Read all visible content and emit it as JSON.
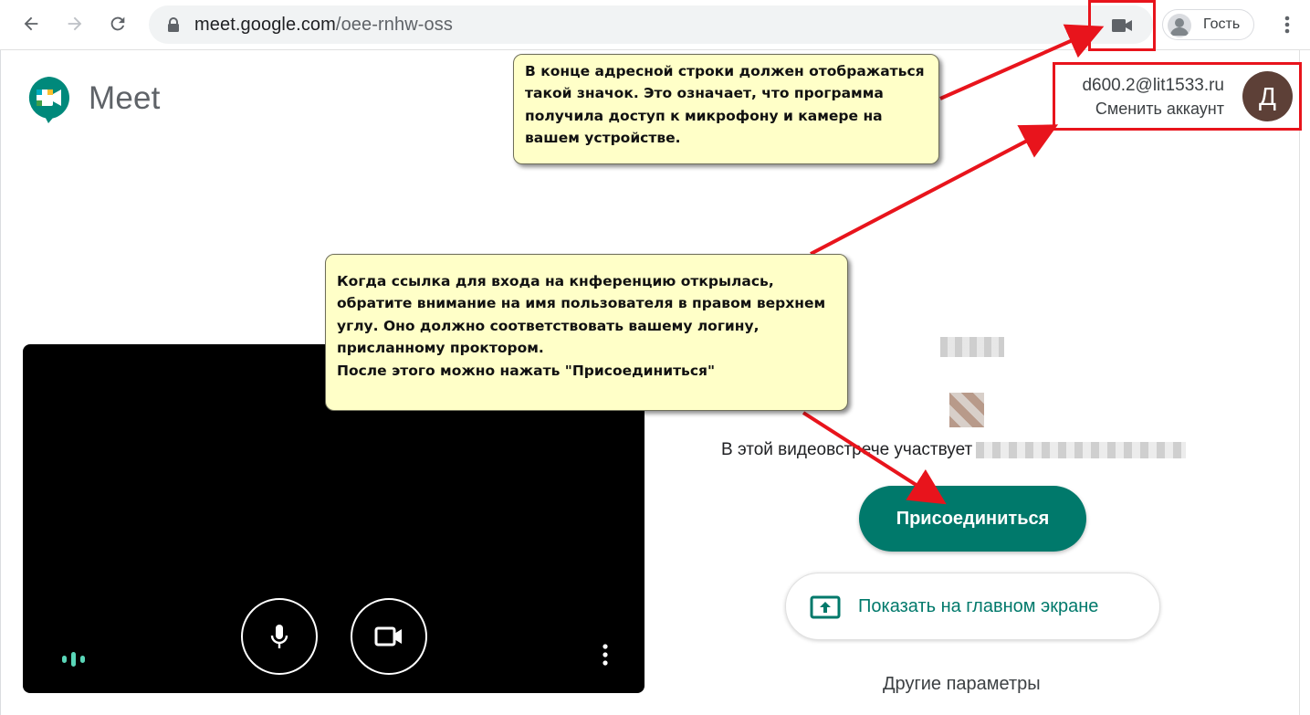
{
  "browser": {
    "url_host": "meet.google.com",
    "url_path": "/oee-rnhw-oss",
    "profile_label": "Гость",
    "icons": [
      "back-arrow-icon",
      "forward-arrow-icon",
      "reload-icon",
      "lock-icon",
      "camera-in-use-icon",
      "profile-icon",
      "more-vert-icon"
    ]
  },
  "meet": {
    "title": "Meet",
    "account": {
      "email": "d600.2@lit1533.ru",
      "switch_label": "Сменить аккаунт",
      "avatar_letter": "Д",
      "avatar_color": "#5d4037"
    },
    "preview": {
      "icons": [
        "microphone-icon",
        "videocam-icon",
        "audio-level-icon",
        "more-vert-icon"
      ]
    },
    "participants_text": "В этой видеовстрече участвует",
    "join_label": "Присоединиться",
    "present_label": "Показать на главном экране",
    "other_options_label": "Другие параметры",
    "accent_color": "#00796b"
  },
  "annotations": {
    "camera_note": [
      "В конце адресной строки должен отображаться",
      "такой значок. Это означает, что программа",
      "получила доступ к микрофону и камере на",
      "вашем устройстве."
    ],
    "login_note": [
      "Когда ссылка для входа на кнференцию открылась,",
      "обратите внимание на имя пользователя в правом верхнем",
      "углу. Оно должно соответствовать вашему логину,",
      "присланному проктором.",
      "После этого можно нажать \"Присоединиться\""
    ],
    "highlight_color": "#e8141c",
    "callout_color": "#ffffc8"
  }
}
